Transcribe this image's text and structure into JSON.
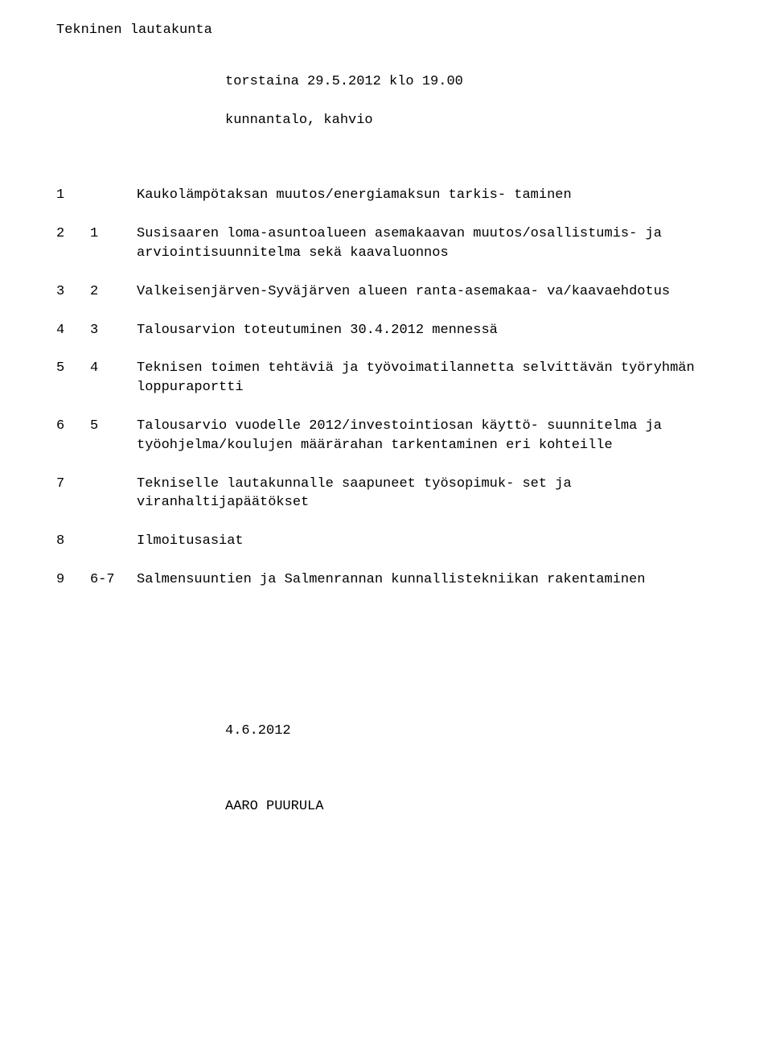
{
  "header": {
    "title": "Tekninen lautakunta",
    "datetime": "torstaina 29.5.2012 klo 19.00",
    "location": "kunnantalo, kahvio"
  },
  "agenda": [
    {
      "num1": "1",
      "num2": "",
      "text": "Kaukolämpötaksan muutos/energiamaksun tarkis-\ntaminen"
    },
    {
      "num1": "2",
      "num2": "1",
      "text": "Susisaaren loma-asuntoalueen asemakaavan\nmuutos/osallistumis- ja arviointisuunnitelma\nsekä kaavaluonnos"
    },
    {
      "num1": "3",
      "num2": "2",
      "text": "Valkeisenjärven-Syväjärven alueen ranta-asemakaa-\nva/kaavaehdotus"
    },
    {
      "num1": "4",
      "num2": "3",
      "text": "Talousarvion toteutuminen 30.4.2012 mennessä"
    },
    {
      "num1": "5",
      "num2": "4",
      "text": "Teknisen toimen tehtäviä ja työvoimatilannetta\nselvittävän työryhmän loppuraportti"
    },
    {
      "num1": "6",
      "num2": "5",
      "text": "Talousarvio vuodelle 2012/investointiosan käyttö-\nsuunnitelma ja työohjelma/koulujen määrärahan\ntarkentaminen eri kohteille"
    },
    {
      "num1": "7",
      "num2": "",
      "text": "Tekniselle lautakunnalle saapuneet työsopimuk-\nset ja viranhaltijapäätökset"
    },
    {
      "num1": "8",
      "num2": "",
      "text": "Ilmoitusasiat"
    },
    {
      "num1": "9",
      "num2": "6-7",
      "text": "Salmensuuntien ja Salmenrannan kunnallistekniikan\nrakentaminen"
    }
  ],
  "footer": {
    "date": "4.6.2012",
    "name": "AARO PUURULA"
  }
}
